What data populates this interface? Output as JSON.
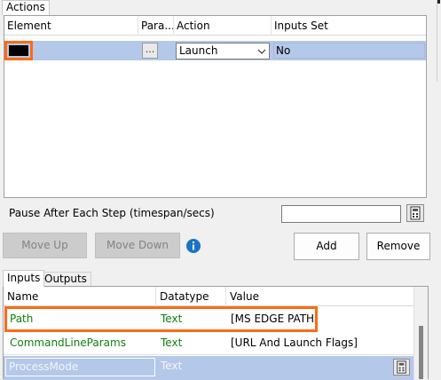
{
  "tabs_top": [
    {
      "label": "Actions"
    }
  ],
  "actions_table": {
    "columns": [
      "Element",
      "Para...",
      "Action",
      "Inputs Set"
    ],
    "row": {
      "element": "",
      "param_button": "...",
      "action": "Launch",
      "inputs_set": "No"
    }
  },
  "pause": {
    "label": "Pause After Each Step (timespan/secs)",
    "value": ""
  },
  "buttons": {
    "move_up": "Move Up",
    "move_down": "Move Down",
    "add": "Add",
    "remove": "Remove"
  },
  "tabs_bottom": [
    {
      "label": "Inputs"
    },
    {
      "label": "Outputs"
    }
  ],
  "inputs_table": {
    "columns": [
      "Name",
      "Datatype",
      "Value"
    ],
    "rows": [
      {
        "name": "Path",
        "datatype": "Text",
        "value": "[MS EDGE PATH]"
      },
      {
        "name": "CommandLineParams",
        "datatype": "Text",
        "value": "[URL And Launch Flags]"
      },
      {
        "name": "ProcessMode",
        "datatype": "Text",
        "value": ""
      }
    ]
  },
  "colors": {
    "highlight": "#ff6a13",
    "selection": "#b4c8ea",
    "green_text": "#108010"
  }
}
